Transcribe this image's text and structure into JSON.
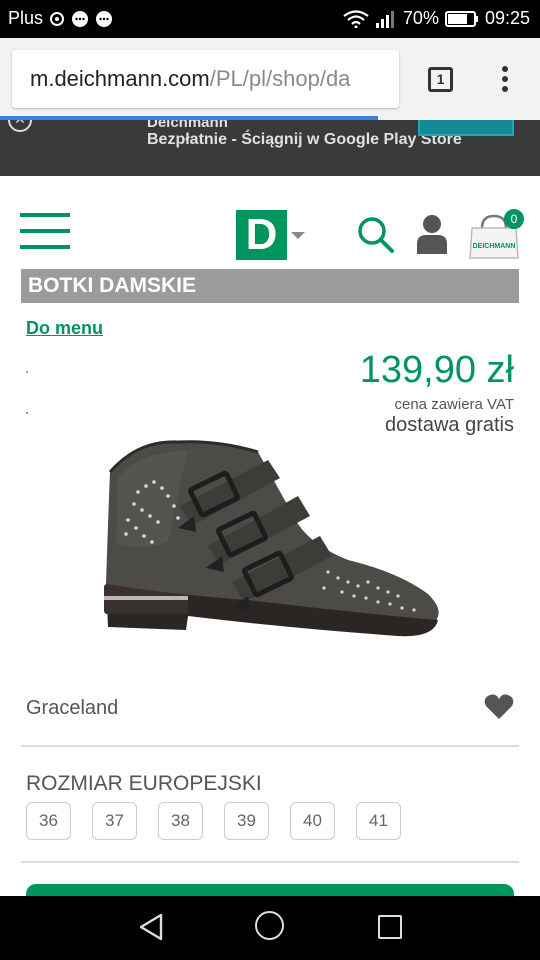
{
  "status_bar": {
    "carrier": "Plus",
    "battery": "70%",
    "time": "09:25"
  },
  "browser": {
    "url_domain": "m.deichmann.com",
    "url_path": "/PL/pl/shop/da",
    "tab_count": "1"
  },
  "app_banner": {
    "app_name": "Deichmann",
    "text": "Bezpłatnie - Ściągnij w Google Play Store"
  },
  "header": {
    "logo_letter": "D",
    "cart_count": "0",
    "cart_bag_label": "DEICHMANN"
  },
  "category": {
    "title": "BOTKI DAMSKIE",
    "back_link": "Do menu"
  },
  "product": {
    "price": "139,90 zł",
    "vat_note": "cena zawiera VAT",
    "shipping": "dostawa gratis",
    "brand": "Graceland"
  },
  "sizes": {
    "heading": "ROZMIAR EUROPEJSKI",
    "options": [
      "36",
      "37",
      "38",
      "39",
      "40",
      "41"
    ]
  },
  "colors": {
    "brand_green": "#00945e",
    "category_gray": "#9b9b9b"
  }
}
